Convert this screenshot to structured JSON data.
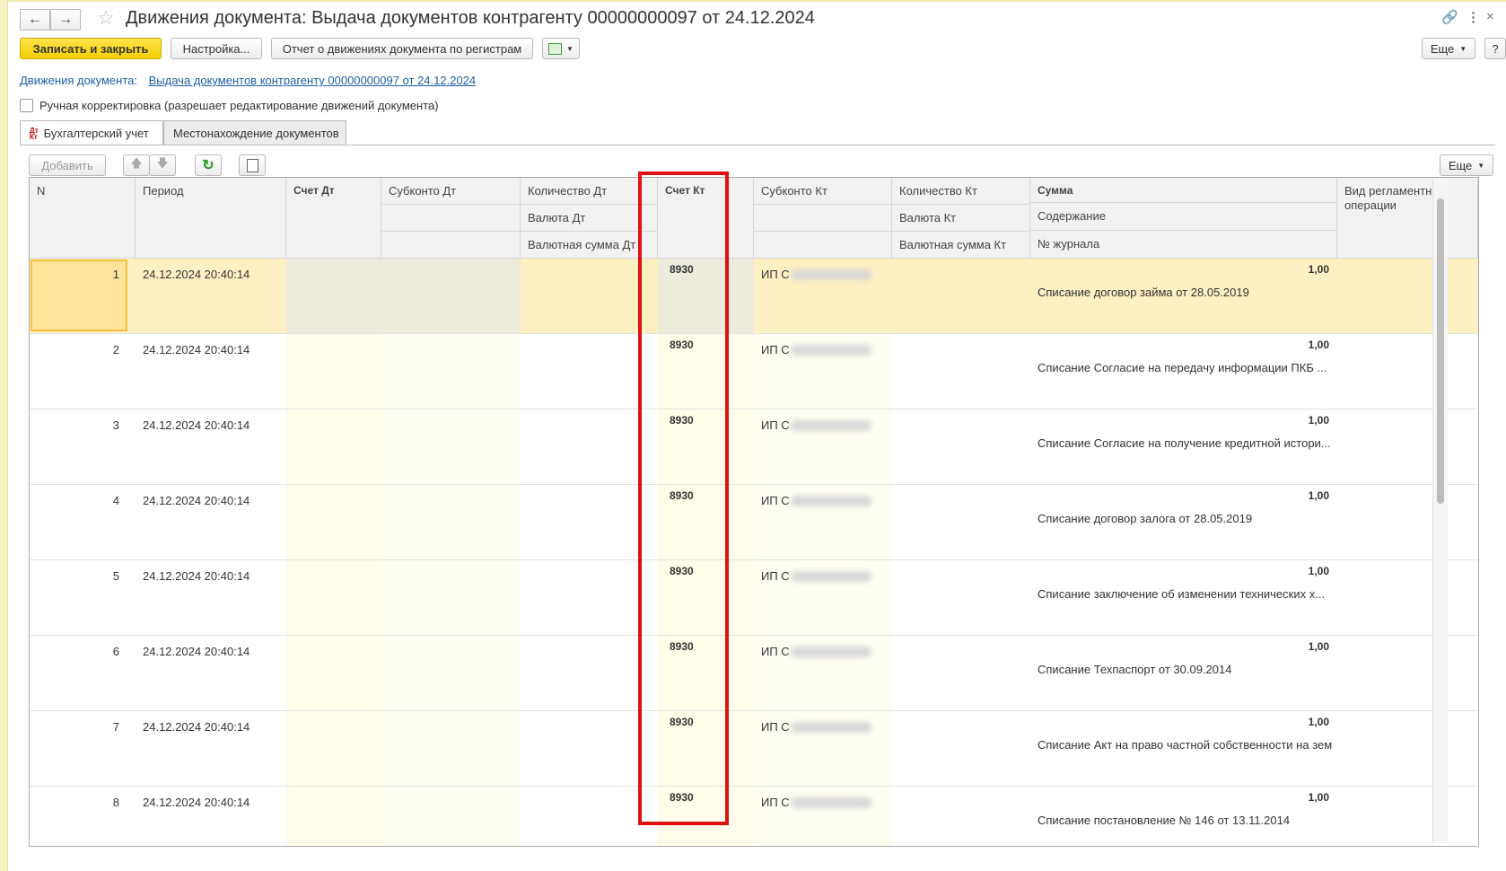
{
  "window": {
    "title": "Движения документа: Выдача документов контрагенту 00000000097 от 24.12.2024"
  },
  "toolbar": {
    "save_close": "Записать и закрыть",
    "settings": "Настройка...",
    "report": "Отчет о движениях документа по регистрам",
    "more": "Еще",
    "help": "?"
  },
  "doc_link": {
    "label": "Движения документа:",
    "value": "Выдача документов контрагенту 00000000097 от 24.12.2024"
  },
  "manual_edit": {
    "label": "Ручная корректировка (разрешает редактирование движений документа)",
    "checked": false
  },
  "tabs": [
    {
      "label": "Бухгалтерский учет",
      "active": true
    },
    {
      "label": "Местонахождение документов",
      "active": false
    }
  ],
  "table_toolbar": {
    "add": "Добавить",
    "more": "Еще"
  },
  "table": {
    "headers": {
      "n": "N",
      "period": "Период",
      "account_dt": "Счет Дт",
      "subconto_dt": "Субконто Дт",
      "qty_dt": "Количество Дт",
      "currency_dt": "Валюта Дт",
      "cur_sum_dt": "Валютная сумма Дт",
      "account_kt": "Счет Кт",
      "subconto_kt": "Субконто Кт",
      "qty_kt": "Количество Кт",
      "currency_kt": "Валюта Кт",
      "cur_sum_kt": "Валютная сумма Кт",
      "sum": "Сумма",
      "content": "Содержание",
      "journal": "№ журнала",
      "op_type": "Вид регламентной операции"
    },
    "rows": [
      {
        "n": "1",
        "period": "24.12.2024 20:40:14",
        "account_kt": "8930",
        "subconto_kt": "ИП С",
        "sum": "1,00",
        "content": "Списание договор займа от 28.05.2019"
      },
      {
        "n": "2",
        "period": "24.12.2024 20:40:14",
        "account_kt": "8930",
        "subconto_kt": "ИП С",
        "sum": "1,00",
        "content": "Списание Согласие на передачу информации ПКБ ..."
      },
      {
        "n": "3",
        "period": "24.12.2024 20:40:14",
        "account_kt": "8930",
        "subconto_kt": "ИП С",
        "sum": "1,00",
        "content": "Списание Согласие на получение кредитной истори..."
      },
      {
        "n": "4",
        "period": "24.12.2024 20:40:14",
        "account_kt": "8930",
        "subconto_kt": "ИП С",
        "sum": "1,00",
        "content": "Списание договор залога от 28.05.2019"
      },
      {
        "n": "5",
        "period": "24.12.2024 20:40:14",
        "account_kt": "8930",
        "subconto_kt": "ИП С",
        "sum": "1,00",
        "content": "Списание заключение об изменении технических х..."
      },
      {
        "n": "6",
        "period": "24.12.2024 20:40:14",
        "account_kt": "8930",
        "subconto_kt": "ИП С",
        "sum": "1,00",
        "content": "Списание Техпаспорт от 30.09.2014"
      },
      {
        "n": "7",
        "period": "24.12.2024 20:40:14",
        "account_kt": "8930",
        "subconto_kt": "ИП С",
        "sum": "1,00",
        "content": "Списание Акт на право частной собственности на зем"
      },
      {
        "n": "8",
        "period": "24.12.2024 20:40:14",
        "account_kt": "8930",
        "subconto_kt": "ИП С",
        "sum": "1,00",
        "content": "Списание постановление № 146 от 13.11.2014"
      }
    ]
  },
  "colors": {
    "primary_button": "#f5cf00",
    "selected_row": "#fdf0c2",
    "highlight_box": "#e01010",
    "link": "#1d5fa5"
  }
}
